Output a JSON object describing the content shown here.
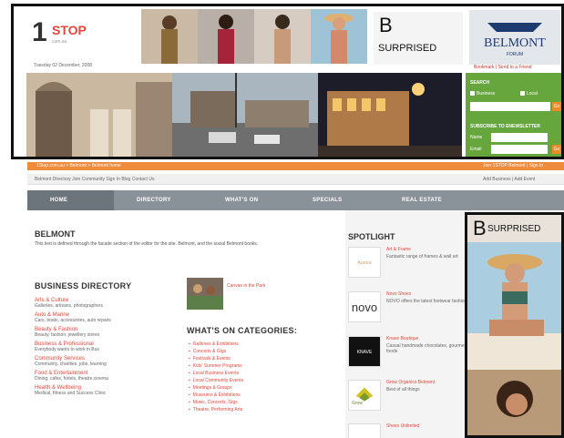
{
  "header": {
    "logo_one": "1",
    "logo_stop": "STOP",
    "logo_domain": "com.au",
    "date": "Tuesday 02 December, 2008",
    "surprised_b": "B",
    "surprised_word": "SURPRISED",
    "belmont_logo": "BELMONT",
    "belmont_sub": "FORUM",
    "top_links": "Bookmark | Send to a Friend"
  },
  "search_panel": {
    "title": "SEARCH",
    "option1": "Business",
    "option2": "Local",
    "newsletter_title": "SUBSCRIBE TO ENEWSLETTER",
    "name_label": "Name",
    "email_label": "Email",
    "go_label": "Go"
  },
  "orange_bar": {
    "left": "1Stop.com.au > Belmont > Belmont home",
    "right": "Join 1STOP Belmont | Sign In"
  },
  "sub_bar": {
    "left": "Belmont Directory   Join Community   Sign In   Blog   Contact Us",
    "right": "Add Business | Add Event"
  },
  "nav": {
    "home": "HOME",
    "directory": "DIRECTORY",
    "whatson": "WHAT'S ON",
    "specials": "SPECIALS",
    "realestate": "REAL ESTATE"
  },
  "intro": {
    "title": "BELMONT",
    "text": "This text is defined through the facade section of the editor for the site. Belmont, and the social Belmont books."
  },
  "business_directory": {
    "title": "BUSINESS DIRECTORY",
    "items": [
      {
        "heading": "Arts & Culture",
        "desc": "Galleries, artisans, photographers"
      },
      {
        "heading": "Auto & Marine",
        "desc": "Cars, boats, accessories, auto repairs"
      },
      {
        "heading": "Beauty & Fashion",
        "desc": "Beauty, fashion, jewellery stores"
      },
      {
        "heading": "Business & Professional",
        "desc": "Everybody wants to work in Bus"
      },
      {
        "heading": "Community Services",
        "desc": "Community, charities, jobs, learning"
      },
      {
        "heading": "Food & Entertainment",
        "desc": "Dining, cafes, hotels, theatre,cinema"
      },
      {
        "heading": "Health & Wellbeing",
        "desc": "Medical, fitness and Success Clinic"
      }
    ]
  },
  "feature_thumb": {
    "caption": "Canvas in the Park"
  },
  "whats_on": {
    "title": "WHAT'S ON CATEGORIES:",
    "items": [
      "Galleries & Exhibitions",
      "Concerts & Gigs",
      "Festivals & Events",
      "Kids' Summer Programs",
      "Local Business Events",
      "Local Community Events",
      "Meetings & Groups",
      "Museums & Exhibitions",
      "Music, Concerts, Gigs",
      "Theatre, Performing Arts"
    ]
  },
  "spotlight": {
    "title": "SPOTLIGHT",
    "items": [
      {
        "logo": "Aurora",
        "title": "Art & Frame",
        "desc": "Fantastic range of frames & wall art"
      },
      {
        "logo": "novo",
        "title": "Novo Shoes",
        "desc": "NOVO offers the latest footwear fashion"
      },
      {
        "logo": "KNAVE",
        "title": "Knave Boutique",
        "desc": "Casual handmade chocolates, gourmet foods"
      },
      {
        "logo": "Grow",
        "title": "Grow Organics Belmont",
        "desc": "Best of all things"
      },
      {
        "logo": "",
        "title": "Shoes Unlimited",
        "desc": ""
      }
    ]
  },
  "side_ad": {
    "b": "B",
    "word": "SURPRISED"
  }
}
